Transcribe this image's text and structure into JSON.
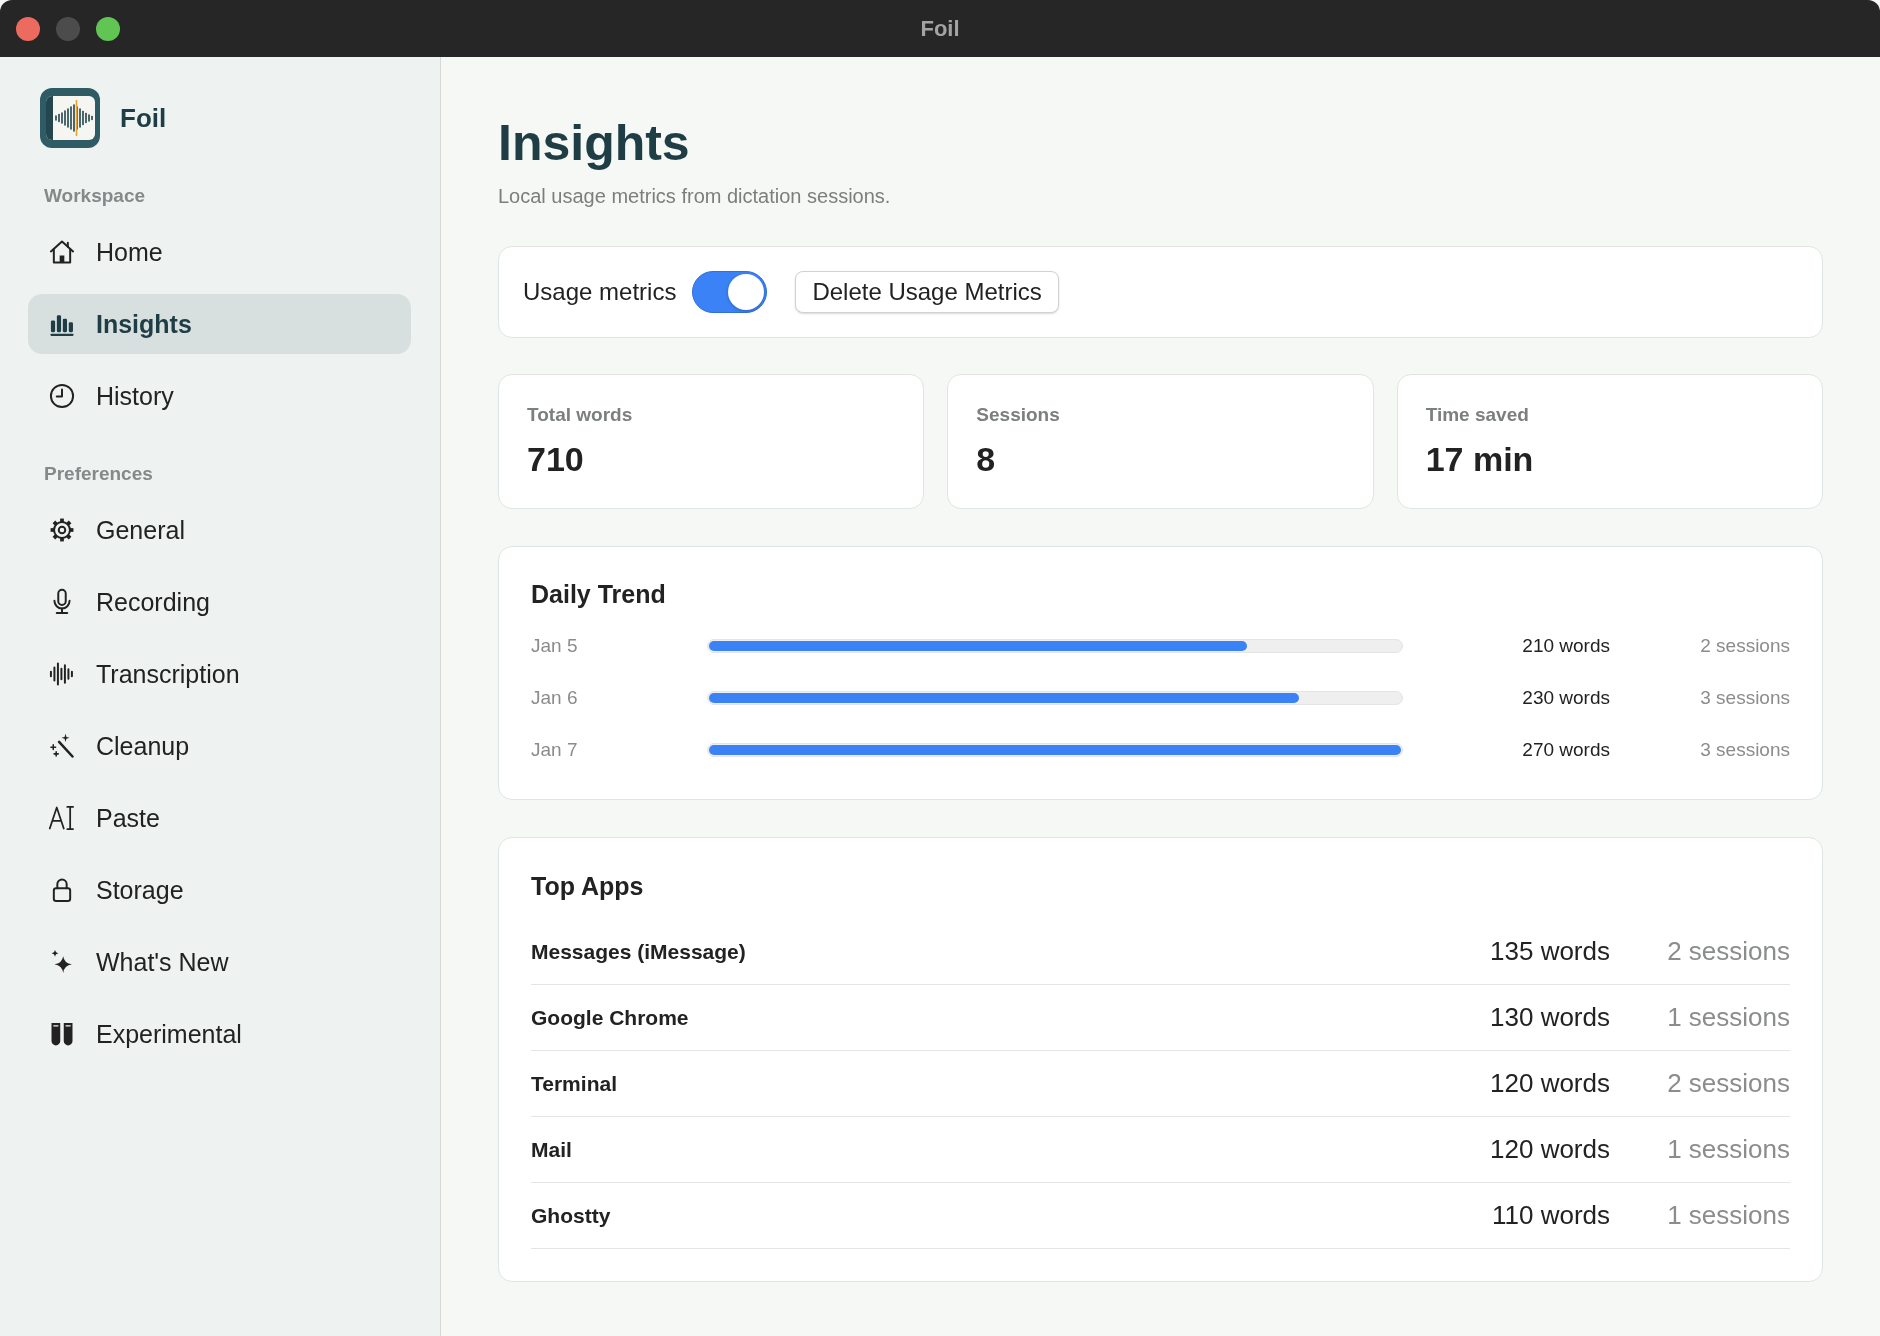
{
  "window": {
    "title": "Foil",
    "controls": [
      {
        "kind": "close",
        "disabled": false
      },
      {
        "kind": "minimize",
        "disabled": true
      },
      {
        "kind": "zoom",
        "disabled": false
      }
    ]
  },
  "sidebar": {
    "app_name": "Foil",
    "sections": [
      {
        "heading": "Workspace",
        "items": [
          {
            "label": "Home",
            "selected": false
          },
          {
            "label": "Insights",
            "selected": true
          },
          {
            "label": "History",
            "selected": false
          }
        ]
      },
      {
        "heading": "Preferences",
        "items": [
          {
            "label": "General",
            "selected": false
          },
          {
            "label": "Recording",
            "selected": false
          },
          {
            "label": "Transcription",
            "selected": false
          },
          {
            "label": "Cleanup",
            "selected": false
          },
          {
            "label": "Paste",
            "selected": false
          },
          {
            "label": "Storage",
            "selected": false
          },
          {
            "label": "What's New",
            "selected": false
          },
          {
            "label": "Experimental",
            "selected": false
          }
        ]
      }
    ]
  },
  "page": {
    "title": "Insights",
    "subtitle": "Local usage metrics from dictation sessions."
  },
  "usage_control": {
    "label": "Usage metrics",
    "toggle": {
      "on": true
    },
    "button": "Delete Usage Metrics"
  },
  "stats": [
    {
      "label": "Total words",
      "value": "710"
    },
    {
      "label": "Sessions",
      "value": "8"
    },
    {
      "label": "Time saved",
      "value": "17 min"
    }
  ],
  "daily_trend": {
    "title": "Daily Trend",
    "rows": [
      {
        "date": "Jan 5",
        "level": 0.778,
        "words": "210 words",
        "sessions": "2 sessions"
      },
      {
        "date": "Jan 6",
        "level": 0.852,
        "words": "230 words",
        "sessions": "3 sessions"
      },
      {
        "date": "Jan 7",
        "level": 1,
        "words": "270 words",
        "sessions": "3 sessions"
      }
    ]
  },
  "top_apps": {
    "title": "Top Apps",
    "rows": [
      {
        "name": "Messages (iMessage)",
        "words": "135 words",
        "sessions": "2 sessions"
      },
      {
        "name": "Google Chrome",
        "words": "130 words",
        "sessions": "1 sessions"
      },
      {
        "name": "Terminal",
        "words": "120 words",
        "sessions": "2 sessions"
      },
      {
        "name": "Mail",
        "words": "120 words",
        "sessions": "1 sessions"
      },
      {
        "name": "Ghostty",
        "words": "110 words",
        "sessions": "1 sessions"
      }
    ]
  }
}
